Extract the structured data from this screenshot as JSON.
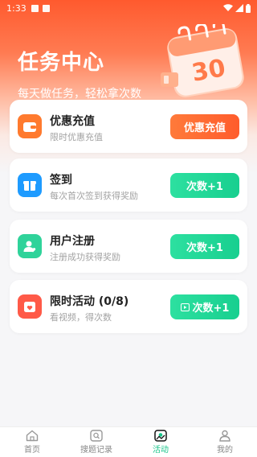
{
  "status_bar": {
    "time": "1:33"
  },
  "hero": {
    "title": "任务中心",
    "subtitle": "每天做任务，轻松拿次数",
    "calendar_number": "30"
  },
  "tasks": [
    {
      "title": "优惠充值",
      "subtitle": "限时优惠充值",
      "button": "优惠充值",
      "icon": "wallet-icon",
      "icon_color": "#ff7a2e",
      "button_color": "#ff6a32"
    },
    {
      "title": "签到",
      "subtitle": "每次首次签到获得奖励",
      "button": "次数+1",
      "icon": "gift-icon",
      "icon_color": "#1e9bff",
      "button_color": "#22d696"
    },
    {
      "title": "用户注册",
      "subtitle": "注册成功获得奖励",
      "button": "次数+1",
      "icon": "user-heart-icon",
      "icon_color": "#2fd39a",
      "button_color": "#22d696"
    },
    {
      "title": "限时活动 (0/8)",
      "subtitle": "看视频，得次数",
      "button": "次数+1",
      "icon": "heart-calendar-icon",
      "icon_color": "#ff5a48",
      "button_color": "#22d696"
    }
  ],
  "tabbar": {
    "items": [
      {
        "label": "首页",
        "icon": "home-icon",
        "active": false
      },
      {
        "label": "搜题记录",
        "icon": "search-record-icon",
        "active": false
      },
      {
        "label": "活动",
        "icon": "activity-icon",
        "active": true
      },
      {
        "label": "我的",
        "icon": "profile-icon",
        "active": false
      }
    ]
  },
  "colors": {
    "primary_orange": "#ff5a2e",
    "accent_green": "#18c58a"
  }
}
